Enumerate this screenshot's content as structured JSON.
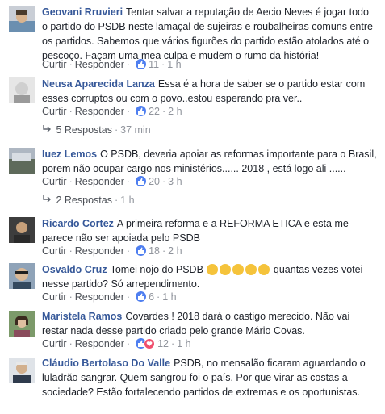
{
  "comments": [
    {
      "name": "Geovani Rruvieri",
      "text": "Tentar salvar a reputação de Aecio Neves é jogar todo o partido do PSDB neste lamaçal de sujeiras e roubalheiras comuns entre os partidos. Sabemos que vários figurões do partido estão atolados até o pescoço. Façam uma mea culpa e mudem o rumo da história!",
      "like": "Curtir",
      "reply": "Responder",
      "count": "11",
      "time": "1 h"
    },
    {
      "name": "Neusa Aparecida Lanza",
      "text": "Essa é a hora de saber se o partido estar com esses corruptos ou com o povo..estou esperando pra ver..",
      "like": "Curtir",
      "reply": "Responder",
      "count": "22",
      "time": "2 h",
      "replies": "5 Respostas",
      "replies_time": "37 min"
    },
    {
      "name": "Iuez Lemos",
      "text": "O PSDB, deveria apoiar as reformas importante para o Brasil, porem não ocupar cargo nos ministérios...... 2018 , está logo ali ......",
      "like": "Curtir",
      "reply": "Responder",
      "count": "20",
      "time": "3 h",
      "replies": "2 Respostas",
      "replies_time": "1 h"
    },
    {
      "name": "Ricardo Cortez",
      "text": "A primeira reforma e a REFORMA ETICA e esta me parece não ser apoiada pelo PSDB",
      "like": "Curtir",
      "reply": "Responder",
      "count": "18",
      "time": "2 h"
    },
    {
      "name": "Osvaldo Cruz",
      "text_a": "Tomei nojo do PSDB",
      "text_b": "quantas vezes votei nesse partido? Só arrependimento.",
      "like": "Curtir",
      "reply": "Responder",
      "count": "6",
      "time": "1 h"
    },
    {
      "name": "Maristela Ramos",
      "text": "Covardes ! 2018 dará o castigo merecido. Não vai restar nada desse partido criado pelo grande Mário Covas.",
      "like": "Curtir",
      "reply": "Responder",
      "count": "12",
      "time": "1 h"
    },
    {
      "name": "Cláudio Bertolaso Do Valle",
      "text": "PSDB, no mensalão ficaram aguardando o luladrão sangrar. Quem sangrou foi o país. Por que virar as costas a sociedade? Estão fortalecendo partidos de extremas e os oportunistas."
    }
  ],
  "colors": {
    "link": "#365899",
    "like_blue": "#4f7ff0",
    "love_red": "#f0506e"
  }
}
